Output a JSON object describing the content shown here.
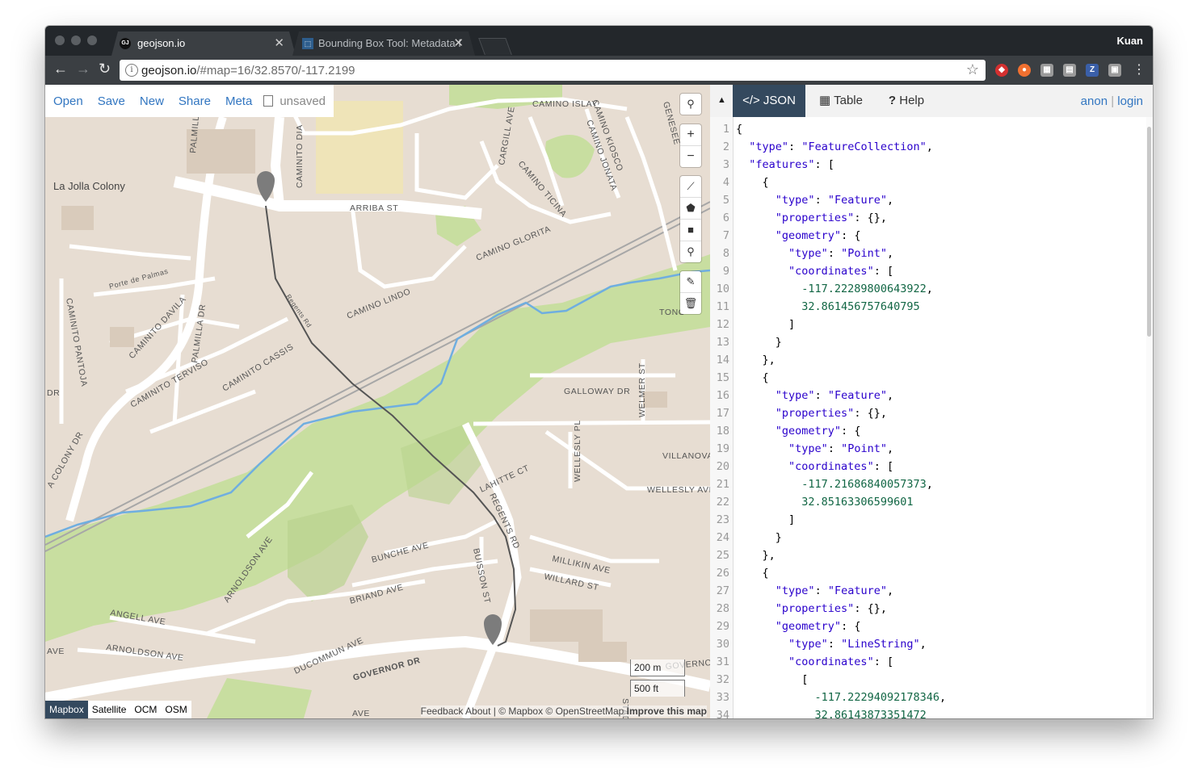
{
  "browser": {
    "user": "Kuan",
    "tabs": [
      {
        "title": "geojson.io",
        "favicon": "GJ",
        "active": true
      },
      {
        "title": "Bounding Box Tool: Metadata f",
        "favicon": "bbox-icon",
        "active": false
      }
    ],
    "url_host": "geojson.io",
    "url_rest": "/#map=16/32.8570/-117.2199",
    "extensions": [
      {
        "name": "ublock-icon",
        "color": "#d43030"
      },
      {
        "name": "reddit-icon",
        "color": "#f07030"
      },
      {
        "name": "grid-icon",
        "color": "#8a8a8a"
      },
      {
        "name": "reader-icon",
        "color": "#8a8a8a"
      },
      {
        "name": "zotero-icon",
        "color": "#3a5fa8",
        "letter": "Z"
      },
      {
        "name": "note-icon",
        "color": "#8a8a8a"
      }
    ]
  },
  "map_menu": {
    "open": "Open",
    "save": "Save",
    "new": "New",
    "share": "Share",
    "meta": "Meta",
    "unsaved": "unsaved"
  },
  "map": {
    "labels": {
      "la_jolla_colony": "La Jolla Colony",
      "arriba_st": "ARRIBA ST",
      "camino_islay": "CAMINO ISLAY",
      "camino_dia": "CAMINITO DIA",
      "camino_lindo": "CAMINO LINDO",
      "camino_glorita": "CAMINO GLORITA",
      "camino_ticina": "CAMINO TICINA",
      "camino_kiosco": "CAMINO KIOSCO",
      "camino_jonata": "CAMINO JONATA",
      "cargill": "CARGILL AVE",
      "palmilla": "PALMILLA DR",
      "palmilla_top": "PALMILLA",
      "porte": "Porte de Palmas",
      "caminito_davila": "CAMINITO DAVILA",
      "caminito_terviso": "CAMINITO TERVISO",
      "caminito_cassis": "CAMINITO CASSIS",
      "caminito_pantoja": "CAMINITO PANTOJA",
      "colony_dr": "A COLONY DR",
      "regents_rd_small": "Regents Rd",
      "regents_rd": "REGENTS RD",
      "galloway": "GALLOWAY DR",
      "welmer": "WELMER ST",
      "wellesly_pl": "WELLESLY PL",
      "villanova": "VILLANOVA",
      "wellesly_ave": "WELLESLY AVE",
      "lahitte": "LAHITTE CT",
      "bunche": "BUNCHE AVE",
      "buisson": "BUISSON ST",
      "millikin": "MILLIKIN AVE",
      "willard": "WILLARD ST",
      "briand": "BRIAND AVE",
      "arnoldson_ave_v": "ARNOLDSON AVE",
      "angell": "ANGELL AVE",
      "arnoldson": "ARNOLDSON AVE",
      "ducommun": "DUCOMMUN AVE",
      "governor": "GOVERNOR DR",
      "governor_r": "GOVERNO",
      "genesee": "GENESEE",
      "tono": "TONO",
      "ave_left": "AVE",
      "ave_bottom": "AVE",
      "std": "STAD",
      "dr_left": "DR"
    },
    "scale_metric": "200 m",
    "scale_imperial": "500 ft",
    "attribution": {
      "feedback": "Feedback",
      "about": "About",
      "copy": "| © Mapbox © OpenStreetMap",
      "improve": "Improve this map"
    },
    "layers": [
      "Mapbox",
      "Satellite",
      "OCM",
      "OSM"
    ],
    "selected_layer": "Mapbox",
    "controls": {
      "search": "search-icon",
      "zoom_in": "+",
      "zoom_out": "−"
    }
  },
  "panel": {
    "tabs": [
      {
        "label": "JSON",
        "icon": "</>",
        "active": true
      },
      {
        "label": "Table",
        "icon": "table-icon",
        "active": false
      },
      {
        "label": "Help",
        "icon": "?",
        "active": false
      }
    ],
    "auth_anon": "anon",
    "auth_sep": "|",
    "auth_login": "login"
  },
  "code_lines": [
    "{",
    "  \"type\": \"FeatureCollection\",",
    "  \"features\": [",
    "    {",
    "      \"type\": \"Feature\",",
    "      \"properties\": {},",
    "      \"geometry\": {",
    "        \"type\": \"Point\",",
    "        \"coordinates\": [",
    "          -117.22289800643922,",
    "          32.861456757640795",
    "        ]",
    "      }",
    "    },",
    "    {",
    "      \"type\": \"Feature\",",
    "      \"properties\": {},",
    "      \"geometry\": {",
    "        \"type\": \"Point\",",
    "        \"coordinates\": [",
    "          -117.21686840057373,",
    "          32.85163306599601",
    "        ]",
    "      }",
    "    },",
    "    {",
    "      \"type\": \"Feature\",",
    "      \"properties\": {},",
    "      \"geometry\": {",
    "        \"type\": \"LineString\",",
    "        \"coordinates\": [",
    "          [",
    "            -117.22294092178346,",
    "            32.86143873351472"
  ]
}
